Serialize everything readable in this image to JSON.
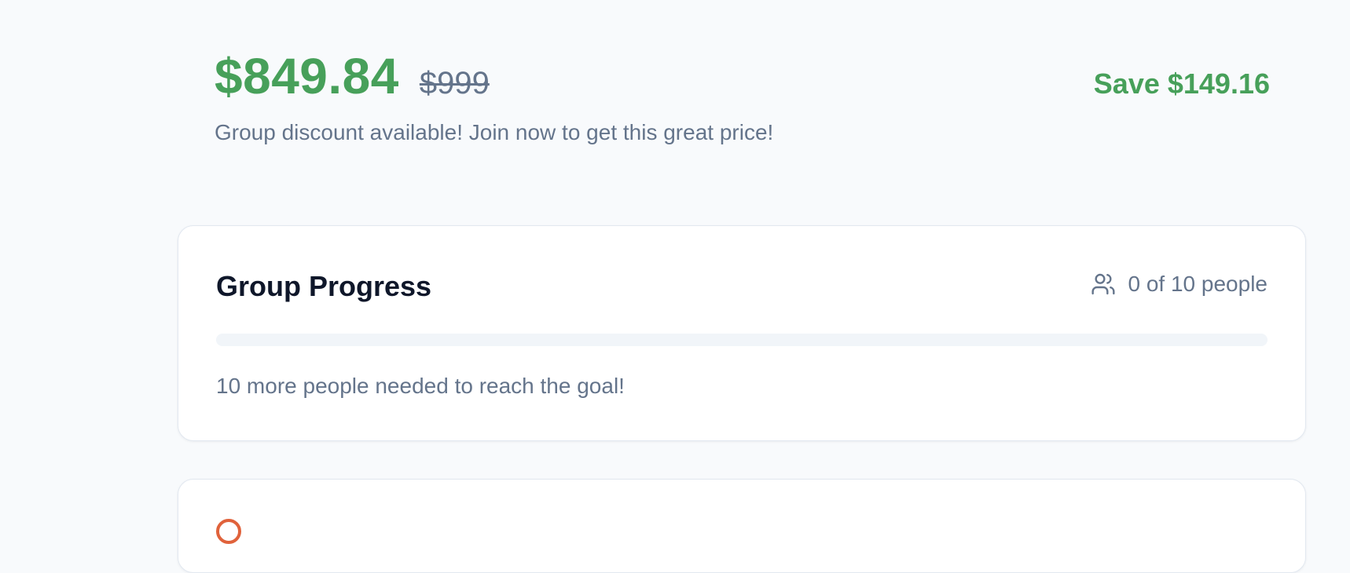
{
  "pricing": {
    "current_price": "$849.84",
    "original_price": "$999",
    "save_label": "Save $149.16",
    "note": "Group discount available! Join now to get this great price!",
    "accent_color": "#47a05a"
  },
  "group_progress": {
    "title": "Group Progress",
    "people_icon": "users-icon",
    "people_text": "0 of 10 people",
    "progress_fraction": 0,
    "note": "10 more people needed to reach the goal!"
  },
  "next_card": {
    "icon": "alert-circle-icon",
    "icon_color": "#e0623b"
  }
}
